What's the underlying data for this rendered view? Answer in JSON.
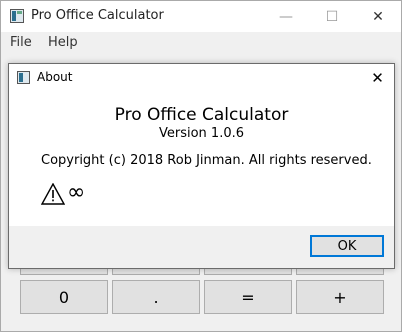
{
  "main_window": {
    "title": "Pro Office Calculator",
    "controls": {
      "minimize": "—",
      "maximize": "☐",
      "close": "✕"
    }
  },
  "menubar": {
    "items": [
      {
        "label": "File"
      },
      {
        "label": "Help"
      }
    ]
  },
  "calculator": {
    "bottom_row": [
      "0",
      ".",
      "=",
      "+"
    ]
  },
  "about_dialog": {
    "title": "About",
    "close": "✕",
    "app_name": "Pro Office Calculator",
    "version": "Version 1.0.6",
    "copyright": "Copyright (c) 2018 Rob Jinman. All rights reserved.",
    "warning_icon": "warning-icon",
    "infinity_symbol": "∞",
    "ok_label": "OK"
  }
}
